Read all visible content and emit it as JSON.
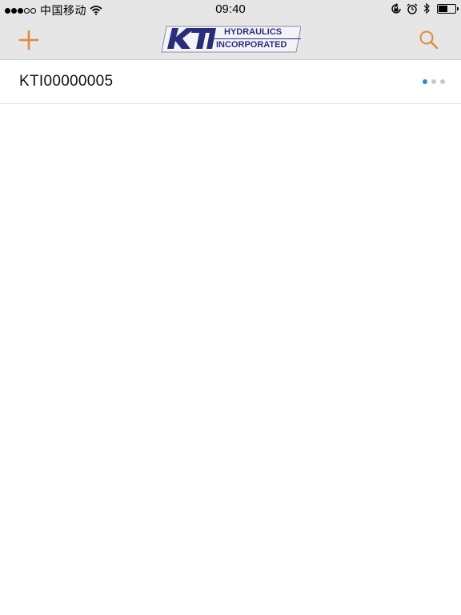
{
  "status_bar": {
    "signal_bars_filled": 3,
    "signal_bars_total": 5,
    "carrier": "中国移动",
    "time": "09:40",
    "icons": [
      "wifi-icon",
      "rotation-lock-icon",
      "alarm-icon",
      "bluetooth-icon",
      "battery-icon"
    ],
    "battery_level": 0.55
  },
  "nav": {
    "add_icon": "plus-icon",
    "search_icon": "search-icon",
    "accent_color": "#e08a3c",
    "logo": {
      "mark": "KTI",
      "line1": "HYDRAULICS",
      "line2": "INCORPORATED",
      "color": "#2a2e7a"
    }
  },
  "list": {
    "items": [
      {
        "title": "KTI00000005",
        "page_dots_total": 3,
        "page_dots_active": 1
      }
    ]
  },
  "colors": {
    "bar_background": "#e6e6e6",
    "page_dot_active": "#2a8ad4",
    "page_dot_inactive": "#c8c8c8"
  }
}
